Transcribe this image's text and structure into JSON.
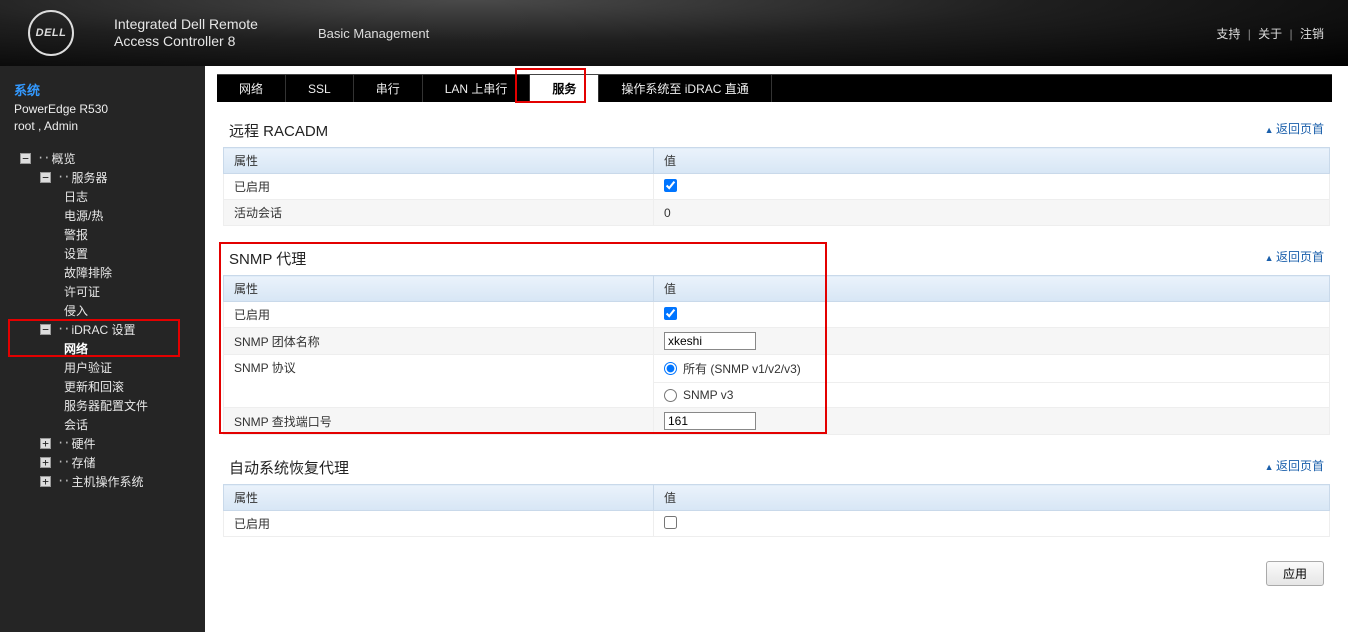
{
  "header": {
    "logo_text": "DELL",
    "product_line1": "Integrated Dell Remote",
    "product_line2": "Access Controller 8",
    "subtitle": "Basic Management",
    "links": {
      "support": "支持",
      "about": "关于",
      "logout": "注销"
    }
  },
  "sidebar": {
    "title": "系统",
    "model": "PowerEdge R530",
    "user": "root , Admin",
    "tree": {
      "overview": "概览",
      "server": "服务器",
      "logs": "日志",
      "power": "电源/热",
      "alerts": "警报",
      "settings": "设置",
      "troubleshoot": "故障排除",
      "license": "许可证",
      "intrusion": "侵入",
      "idrac": "iDRAC 设置",
      "network": "网络",
      "auth": "用户验证",
      "update": "更新和回滚",
      "profile": "服务器配置文件",
      "session": "会话",
      "hardware": "硬件",
      "storage": "存储",
      "hostos": "主机操作系统"
    }
  },
  "tabs": {
    "network": "网络",
    "ssl": "SSL",
    "serial": "串行",
    "lan": "LAN 上串行",
    "services": "服务",
    "osidrac": "操作系统至 iDRAC 直通"
  },
  "sections": {
    "racadm": {
      "title": "远程 RACADM",
      "back": "返回页首",
      "col_attr": "属性",
      "col_val": "值",
      "enabled": "已启用",
      "sessions": "活动会话",
      "sessions_val": "0"
    },
    "snmp": {
      "title": "SNMP 代理",
      "back": "返回页首",
      "col_attr": "属性",
      "col_val": "值",
      "enabled": "已启用",
      "community": "SNMP 团体名称",
      "community_val": "xkeshi",
      "protocol": "SNMP 协议",
      "proto_all": "所有 (SNMP v1/v2/v3)",
      "proto_v3": "SNMP v3",
      "port": "SNMP 查找端口号",
      "port_val": "161"
    },
    "autorecover": {
      "title": "自动系统恢复代理",
      "back": "返回页首",
      "col_attr": "属性",
      "col_val": "值",
      "enabled": "已启用"
    }
  },
  "buttons": {
    "apply": "应用"
  }
}
